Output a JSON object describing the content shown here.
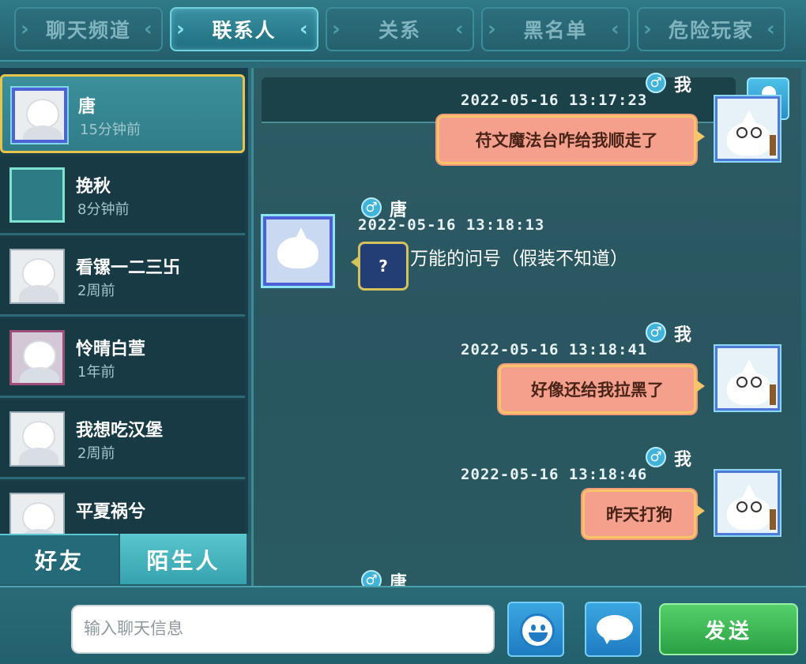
{
  "tabs": [
    {
      "label": "聊天频道",
      "active": false
    },
    {
      "label": "联系人",
      "active": true
    },
    {
      "label": "关系",
      "active": false
    },
    {
      "label": "黑名单",
      "active": false
    },
    {
      "label": "危险玩家",
      "active": false
    }
  ],
  "contacts": [
    {
      "name": "唐",
      "time": "15分钟前",
      "selected": true
    },
    {
      "name": "挽秋",
      "time": "8分钟前"
    },
    {
      "name": "看镙一二三卐",
      "time": "2周前"
    },
    {
      "name": "怜晴白萱",
      "time": "1年前"
    },
    {
      "name": "我想吃汉堡",
      "time": "2周前"
    },
    {
      "name": "平夏祸兮",
      "time": ""
    }
  ],
  "list_tabs": {
    "friends": "好友",
    "strangers": "陌生人"
  },
  "messages": [
    {
      "sender": "我",
      "gender": "♂",
      "timestamp": "2022-05-16  13:17:23",
      "text": "苻文魔法台咋给我顺走了",
      "side": "out"
    },
    {
      "sender": "唐",
      "gender": "♂",
      "timestamp": "2022-05-16  13:18:13",
      "text": "?",
      "side": "in"
    },
    {
      "sender": "我",
      "gender": "♂",
      "timestamp": "2022-05-16  13:18:41",
      "text": "好像还给我拉黑了",
      "side": "out"
    },
    {
      "sender": "我",
      "gender": "♂",
      "timestamp": "2022-05-16  13:18:46",
      "text": "昨天打狗",
      "side": "out"
    },
    {
      "sender": "唐",
      "gender": "♂",
      "side": "in"
    }
  ],
  "caption_overlay": "万能的问号（假装不知道）",
  "input": {
    "placeholder": "输入聊天信息",
    "value": ""
  },
  "send_label": "发送",
  "colors": {
    "active_tab_border": "#6fd2df",
    "selected_border": "#e8c44a",
    "bubble_out": "#f4a08d",
    "send_button": "#2aa043"
  }
}
